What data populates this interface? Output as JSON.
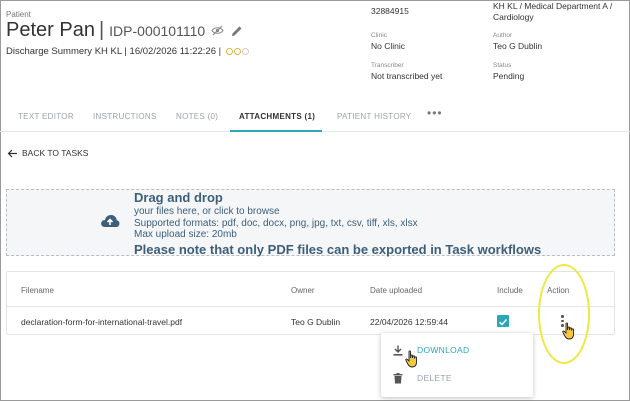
{
  "header": {
    "patient_label": "Patient",
    "patient_name": "Peter Pan",
    "separator": "|",
    "patient_id": "IDP-000101110",
    "subtitle": "Discharge Summery KH KL | 16/02/2026 11:22:26 |"
  },
  "meta": {
    "task_id_value": "32884915",
    "department_value": "KH KL / Medical Department A / Cardiology",
    "clinic_label": "Clinic",
    "clinic_value": "No Clinic",
    "author_label": "Author",
    "author_value": "Teo G Dublin",
    "transcriber_label": "Transcriber",
    "transcriber_value": "Not transcribed yet",
    "status_label": "Status",
    "status_value": "Pending"
  },
  "tabs": [
    {
      "label": "TEXT EDITOR",
      "active": false
    },
    {
      "label": "INSTRUCTIONS",
      "active": false
    },
    {
      "label": "NOTES (0)",
      "active": false
    },
    {
      "label": "ATTACHMENTS (1)",
      "active": true
    },
    {
      "label": "PATIENT HISTORY",
      "active": false
    }
  ],
  "tab_more": "•••",
  "back_label": "BACK TO TASKS",
  "dropzone": {
    "title": "Drag and drop",
    "line1": "your files here, or click to browse",
    "line2": "Supported formats: pdf, doc, docx, png, jpg, txt, csv, tiff, xls, xlsx",
    "line3": "Max upload size: 20mb",
    "note": "Please note that only PDF files can be exported in Task workflows"
  },
  "table": {
    "columns": [
      "Filename",
      "Owner",
      "Date uploaded",
      "Include",
      "Action"
    ],
    "rows": [
      {
        "filename": "declaration-form-for-international-travel.pdf",
        "owner": "Teo G Dublin",
        "date": "22/04/2026 12:59:44",
        "include": true
      }
    ]
  },
  "menu": {
    "download": "DOWNLOAD",
    "delete": "DELETE"
  },
  "colors": {
    "accent": "#2aa7b8",
    "dropzone_text": "#3d5f7a",
    "highlight": "#eee840"
  }
}
